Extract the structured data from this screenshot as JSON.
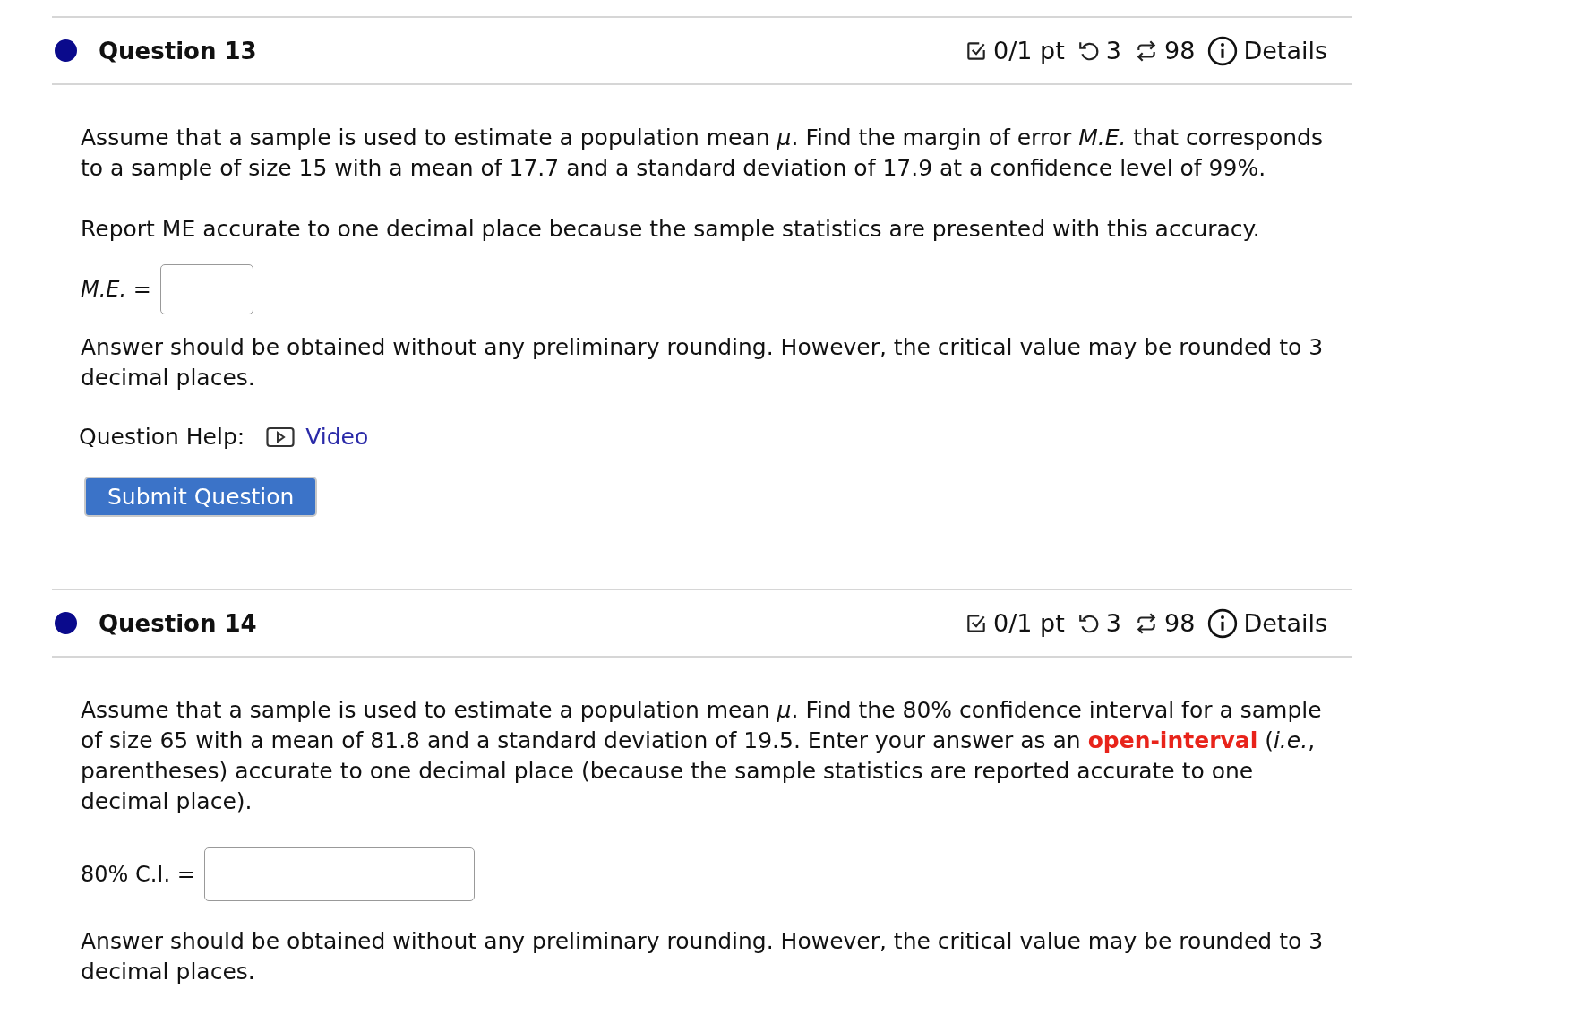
{
  "questions": [
    {
      "title": "Question 13",
      "score": "0/1 pt",
      "attempts": "3",
      "versions": "98",
      "details": "Details",
      "blocks": [
        {
          "kind": "paragraph",
          "segments": [
            {
              "text": "Assume that a sample is used to estimate a population mean *μ*. Find the margin of error *M.E.* that corresponds to a sample of size 15 with a mean of 17.7 and a standard deviation of 17.9 at a confidence level of 99%.",
              "emphasis": false
            }
          ]
        },
        {
          "kind": "paragraph",
          "segments": [
            {
              "text": "Report ME accurate to one decimal place because the sample statistics are presented with this accuracy.",
              "emphasis": false
            }
          ]
        },
        {
          "kind": "short-answer",
          "label": "*M.E.* ="
        },
        {
          "kind": "paragraph",
          "segments": [
            {
              "text": "Answer should be obtained without any preliminary rounding. However, the critical value may be rounded to 3 decimal places.",
              "emphasis": false
            }
          ]
        },
        {
          "kind": "help",
          "label": "Question Help:",
          "link": "Video"
        },
        {
          "kind": "button",
          "label": "Submit Question"
        }
      ]
    },
    {
      "title": "Question 14",
      "score": "0/1 pt",
      "attempts": "3",
      "versions": "98",
      "details": "Details",
      "blocks": [
        {
          "kind": "paragraph",
          "segments": [
            {
              "text": "Assume that a sample is used to estimate a population mean *μ*. Find the 80% confidence interval for a sample of size 65 with a mean of 81.8 and a standard deviation of 19.5. Enter your answer as an ",
              "emphasis": false
            },
            {
              "text": "open-interval",
              "emphasis": true
            },
            {
              "text": " (*i.e.*, parentheses) accurate to one decimal place (because the sample statistics are reported accurate to one decimal place).",
              "emphasis": false
            }
          ]
        },
        {
          "kind": "interval-answer",
          "label": "80% C.I. ="
        },
        {
          "kind": "paragraph",
          "segments": [
            {
              "text": "Answer should be obtained without any preliminary rounding. However, the critical value may be rounded to 3 decimal places.",
              "emphasis": false
            }
          ]
        }
      ]
    }
  ]
}
